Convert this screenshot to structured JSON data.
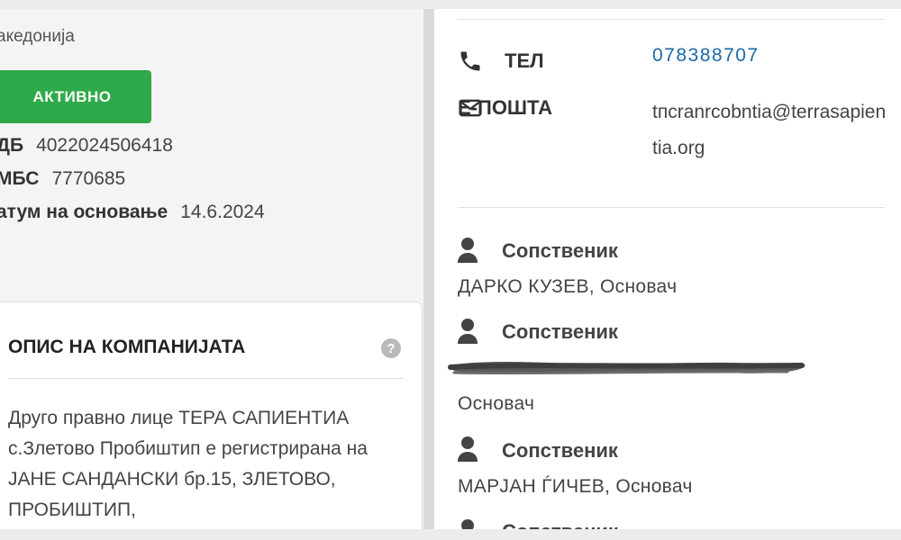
{
  "company": {
    "country": "акедонија",
    "status_label": "АКТИВНО",
    "fields": [
      {
        "key": "ДБ",
        "value": "4022024506418"
      },
      {
        "key": "МБС",
        "value": "7770685"
      },
      {
        "key": "атум на основање",
        "value": "14.6.2024"
      }
    ]
  },
  "description": {
    "title": "ОПИС НА КОМПАНИЈАТА",
    "help_glyph": "?",
    "text": "Друго правно лице ТЕРА САПИЕНТИА с.Злетово Пробиштип е регистрирана на ЈАНЕ САНДАНСКИ бр.15, ЗЛЕТОВО, ПРОБИШТИП,"
  },
  "contact": {
    "phone_label": "ТЕЛ",
    "phone_value": "078388707",
    "email_label": "Е-ПОШТА",
    "email_value": "tпcranrcobntia@terrasapientia.org",
    "icons": {
      "phone": "phone-icon",
      "email": "envelope-icon"
    }
  },
  "owners": [
    {
      "label": "Сопственик",
      "name": "ДАРКО КУЗЕВ, Основач"
    },
    {
      "label": "Сопственик",
      "name": "Основач"
    },
    {
      "label": "Сопственик",
      "name": "МАРЈАН ЃИЧЕВ, Основач"
    },
    {
      "label": "Сопственик",
      "name": ""
    }
  ],
  "colors": {
    "status_green": "#2eaa4a",
    "phone_link": "#1b6aa8",
    "help_icon": "#b9b9b9"
  }
}
